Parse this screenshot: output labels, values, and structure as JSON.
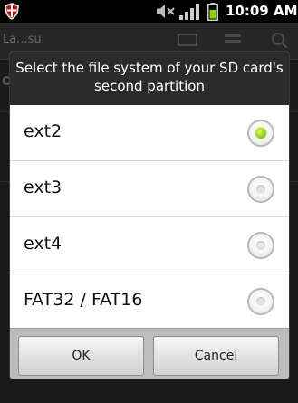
{
  "status_bar": {
    "time": "10:09 AM",
    "icons": [
      "shield-icon",
      "mute-icon",
      "signal-icon",
      "battery-icon"
    ]
  },
  "background_app": {
    "title": "La...su",
    "letter": "O",
    "icons": [
      "search-icon"
    ]
  },
  "dialog": {
    "title": "Select the file system of your SD card's second partition",
    "options": [
      {
        "label": "ext2",
        "checked": true
      },
      {
        "label": "ext3",
        "checked": false
      },
      {
        "label": "ext4",
        "checked": false
      },
      {
        "label": "FAT32 / FAT16",
        "checked": false
      }
    ],
    "buttons": {
      "ok": "OK",
      "cancel": "Cancel"
    }
  },
  "colors": {
    "accent": "#9bd21e",
    "battery": "#8cd400",
    "title_bar": "#2b2b2b"
  }
}
